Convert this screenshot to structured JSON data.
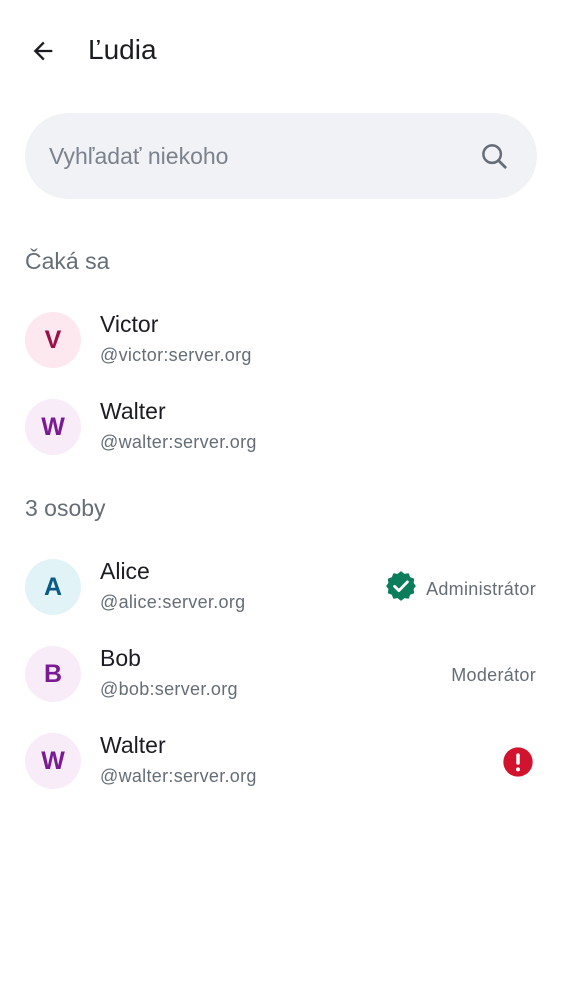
{
  "header": {
    "title": "Ľudia",
    "back_icon": "arrow-left-icon"
  },
  "search": {
    "placeholder": "Vyhľadať niekoho",
    "value": "",
    "icon": "search-icon"
  },
  "sections": {
    "pending": {
      "label": "Čaká sa",
      "members": [
        {
          "initial": "V",
          "name": "Victor",
          "user_id": "@victor:server.org",
          "avatar_bg": "#fce8ee",
          "avatar_fg": "#9b1049"
        },
        {
          "initial": "W",
          "name": "Walter",
          "user_id": "@walter:server.org",
          "avatar_bg": "#f9ecf9",
          "avatar_fg": "#7b1b93"
        }
      ]
    },
    "joined": {
      "label": "3 osoby",
      "members": [
        {
          "initial": "A",
          "name": "Alice",
          "user_id": "@alice:server.org",
          "avatar_bg": "#e2f3f8",
          "avatar_fg": "#0a5a86",
          "role": "Administrátor",
          "role_icon": "verified-badge-icon"
        },
        {
          "initial": "B",
          "name": "Bob",
          "user_id": "@bob:server.org",
          "avatar_bg": "#f9ecf9",
          "avatar_fg": "#7b1b93",
          "role": "Moderátor"
        },
        {
          "initial": "W",
          "name": "Walter",
          "user_id": "@walter:server.org",
          "avatar_bg": "#f9ecf9",
          "avatar_fg": "#7b1b93",
          "status_icon": "error-alert-icon"
        }
      ]
    }
  },
  "colors": {
    "verified": "#0b7d5a",
    "alert": "#d1132d",
    "secondary_text": "#656d77",
    "search_bg": "#f0f2f5"
  }
}
